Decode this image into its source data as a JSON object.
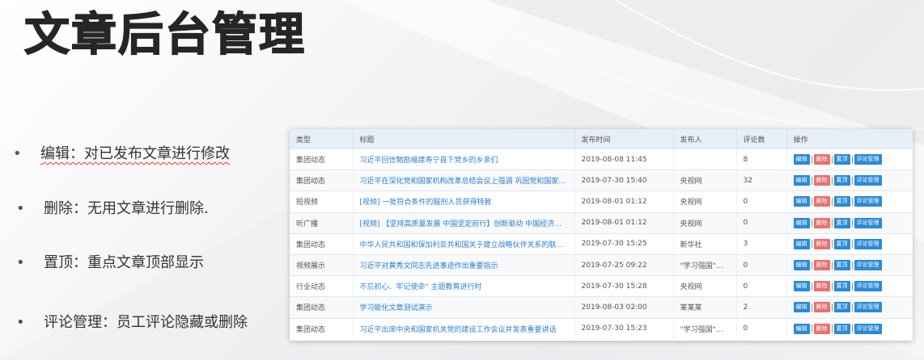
{
  "slide": {
    "title": "文章后台管理"
  },
  "bullets": [
    {
      "marker": "•",
      "text": "编辑：对已发布文章进行修改"
    },
    {
      "marker": "•",
      "text": "删除：无用文章进行删除."
    },
    {
      "marker": "•",
      "text": "置顶：重点文章顶部显示"
    },
    {
      "marker": "•",
      "text": "评论管理：员工评论隐藏或删除"
    }
  ],
  "table": {
    "headers": [
      "类型",
      "标题",
      "发布时间",
      "发布人",
      "评论数",
      "操作"
    ],
    "rows": [
      {
        "type": "集团动态",
        "title": "习近平回信勉励福建寿宁县下党乡的乡亲们",
        "time": "2019-08-08 11:45",
        "publisher": "",
        "comments": "8"
      },
      {
        "type": "集团动态",
        "title": "习近平在深化党和国家机构改革总结会议上强调 巩固党和国家机构改革成...",
        "time": "2019-07-30 15:40",
        "publisher": "央视网",
        "comments": "32"
      },
      {
        "type": "短视频",
        "title": "[视频] 一批符合条件的服刑人员获得特赦",
        "time": "2019-08-01 01:12",
        "publisher": "央视网",
        "comments": "0"
      },
      {
        "type": "听广播",
        "title": "[视频] 【坚持高质量发展 中国坚定前行】创新驱动 中国经济加快动能转换",
        "time": "2019-08-01 01:12",
        "publisher": "央视网",
        "comments": "0"
      },
      {
        "type": "集团动态",
        "title": "中华人民共和国和保加利亚共和国关于建立战略伙伴关系的联合声明",
        "time": "2019-07-30 15:25",
        "publisher": "新华社",
        "comments": "3"
      },
      {
        "type": "视频展示",
        "title": "习近平对黄秀文同志先进事迹作出重要指示",
        "time": "2019-07-25 09:22",
        "publisher": "\"学习强国\"学习...",
        "comments": "0"
      },
      {
        "type": "行业动态",
        "title": "不忘初心、牢记使命\" 主题教育进行时",
        "time": "2019-07-30 15:28",
        "publisher": "央视网",
        "comments": "0"
      },
      {
        "type": "集团动态",
        "title": "学习能化文章测试演示",
        "time": "2019-08-03 02:00",
        "publisher": "某某某",
        "comments": "2"
      },
      {
        "type": "集团动态",
        "title": "习近平出席中央和国家机关党的建设工作会议并发表重要讲话",
        "time": "2019-07-30 15:23",
        "publisher": "\"学习强国\"学习...",
        "comments": "0"
      }
    ],
    "actions": {
      "edit": "编辑",
      "delete": "删除",
      "pin": "置顶",
      "comments": "评论管理"
    }
  },
  "colors": {
    "action_blue": "#2a8ad8",
    "action_red": "#e9716e",
    "link": "#2b7fd0",
    "header_bg": "#e6eef8"
  }
}
